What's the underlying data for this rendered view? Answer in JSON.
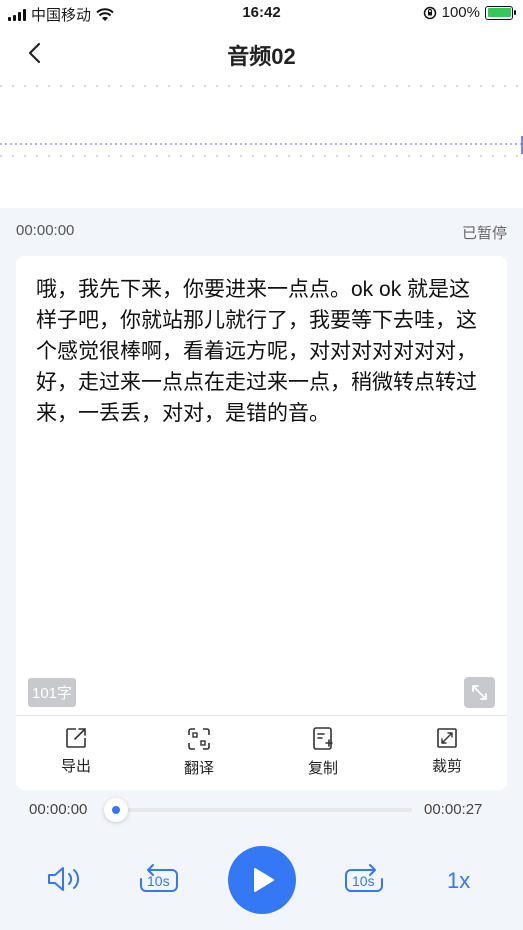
{
  "status": {
    "carrier": "中国移动",
    "time": "16:42",
    "battery": "100%"
  },
  "header": {
    "title": "音频02"
  },
  "recording": {
    "elapsed": "00:00:00",
    "state": "已暂停"
  },
  "transcript": {
    "text": "哦，我先下来，你要进来一点点。ok ok 就是这样子吧，你就站那儿就行了，我要等下去哇，这个感觉很棒啊，看着远方呢，对对对对对对对，好，走过来一点点在走过来一点，稍微转点转过来，一丢丢，对对，是错的音。",
    "char_count": "101字"
  },
  "actions": [
    {
      "label": "导出",
      "icon": "export-icon"
    },
    {
      "label": "翻译",
      "icon": "translate-icon"
    },
    {
      "label": "复制",
      "icon": "copy-icon"
    },
    {
      "label": "裁剪",
      "icon": "crop-icon"
    }
  ],
  "player": {
    "current": "00:00:00",
    "total": "00:00:27",
    "progress": 0,
    "skip_back": "10s",
    "skip_forward": "10s",
    "speed": "1x"
  },
  "colors": {
    "accent": "#3478f6",
    "background": "#f2f5fa"
  }
}
